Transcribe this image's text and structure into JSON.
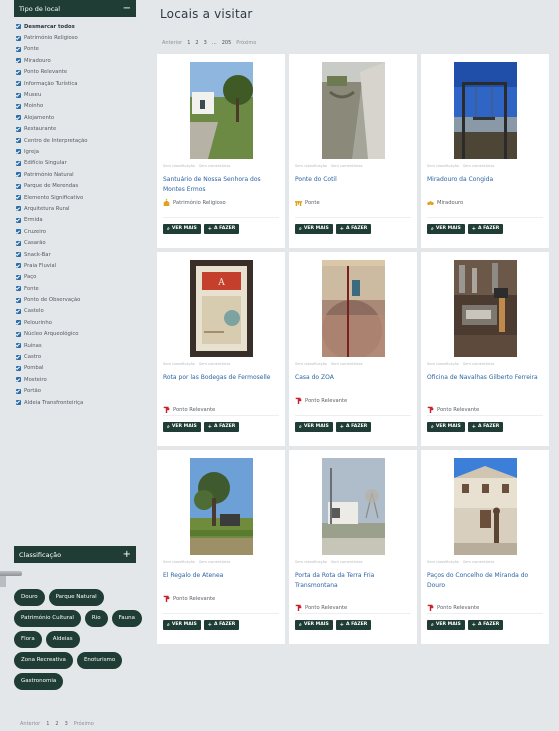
{
  "sidebar": {
    "tipo_title": "Tipo de local",
    "tipo_toggle": "−",
    "filters": [
      "Desmarcar todos",
      "Património Religioso",
      "Ponte",
      "Miradouro",
      "Ponto Relevante",
      "Informação Turística",
      "Museu",
      "Moinho",
      "Alojamento",
      "Restaurante",
      "Centro de Interpretação",
      "Igreja",
      "Edifício Singular",
      "Património Natural",
      "Parque de Merendas",
      "Elemento Significativo",
      "Arquitetura Rural",
      "Ermida",
      "Cruzeiro",
      "Casarão",
      "Snack-Bar",
      "Praia Fluvial",
      "Paço",
      "Fonte",
      "Ponto de Observação",
      "Castelo",
      "Pelourinho",
      "Núcleo Arqueológico",
      "Ruínas",
      "Castro",
      "Pombal",
      "Mosteiro",
      "Portão",
      "Aldeia Transfronteiriça"
    ],
    "class_title": "Classificação",
    "class_toggle": "+",
    "tags": [
      "Douro",
      "Parque Natural",
      "Património Cultural",
      "Rio",
      "Fauna",
      "Flora",
      "Aldeias",
      "Zona Recreativa",
      "Enoturismo",
      "Gastronomia"
    ],
    "pager": {
      "prev": "Anterior",
      "p1": "1",
      "p2": "2",
      "p3": "3",
      "next": "Próximo"
    }
  },
  "main": {
    "title": "Locais a visitar",
    "pager": {
      "prev": "Anterior",
      "p1": "1",
      "p2": "2",
      "p3": "3",
      "dots": "…",
      "last": "205",
      "next": "Próximo"
    }
  },
  "card_labels": {
    "meta_left": "Sem classificação",
    "meta_right": "Sem comentários",
    "see_more": "VER MAIS",
    "todo": "A FAZER"
  },
  "cards": [
    {
      "name": "Santuário de Nossa Senhora dos Montes Ermos",
      "category": "Património Religioso",
      "category_icon": "church-icon",
      "category_color": "#e0a21a"
    },
    {
      "name": "Ponte do Cotil",
      "category": "Ponte",
      "category_icon": "bridge-icon",
      "category_color": "#e0a21a"
    },
    {
      "name": "Miradouro da Congida",
      "category": "Miradouro",
      "category_icon": "binoculars-icon",
      "category_color": "#e0a21a"
    },
    {
      "name": "Rota por las Bodegas de Fermoselle",
      "category": "Ponto Relevante",
      "category_icon": "pin-icon",
      "category_color": "#c8202a"
    },
    {
      "name": "Casa do ZOA",
      "category": "Ponto Relevante",
      "category_icon": "pin-icon",
      "category_color": "#c8202a"
    },
    {
      "name": "Oficina de Navalhas Gilberto Ferreira",
      "category": "Ponto Relevante",
      "category_icon": "pin-icon",
      "category_color": "#c8202a"
    },
    {
      "name": "El Regalo de Atenea",
      "category": "Ponto Relevante",
      "category_icon": "pin-icon",
      "category_color": "#c8202a"
    },
    {
      "name": "Porta da Rota da Terra Fria Transmontana",
      "category": "Ponto Relevante",
      "category_icon": "pin-icon",
      "category_color": "#c8202a"
    },
    {
      "name": "Paços do Concelho de Miranda do Douro",
      "category": "Ponto Relevante",
      "category_icon": "pin-icon",
      "category_color": "#c8202a"
    }
  ]
}
